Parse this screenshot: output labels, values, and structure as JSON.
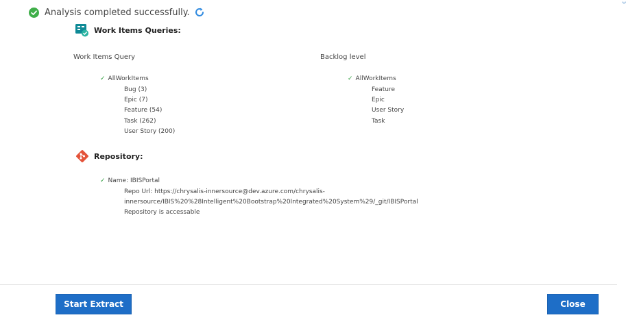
{
  "status": {
    "message": "Analysis completed successfully.",
    "success_icon": "check-circle-icon",
    "refresh_icon": "refresh-icon",
    "success_color": "#3fae49",
    "refresh_color": "#2f8ae0"
  },
  "work_items": {
    "title": "Work Items Queries:",
    "icon": "boards-icon",
    "columns": [
      {
        "header": "Work Items Query",
        "root": "AllWorkItems",
        "children": [
          "Bug (3)",
          "Epic (7)",
          "Feature (54)",
          "Task (262)",
          "User Story (200)"
        ]
      },
      {
        "header": "Backlog level",
        "root": "AllWorkItems",
        "children": [
          "Feature",
          "Epic",
          "User Story",
          "Task"
        ]
      }
    ]
  },
  "repository": {
    "title": "Repository:",
    "icon": "git-icon",
    "name_line": "Name: IBISPortal",
    "url_line1": "Repo Url: https://chrysalis-innersource@dev.azure.com/chrysalis-",
    "url_line2": "innersource/IBIS%20%28Intelligent%20Bootstrap%20Integrated%20System%29/_git/IBISPortal",
    "access_line": "Repository is accessable"
  },
  "footer": {
    "start_label": "Start Extract",
    "close_label": "Close",
    "accent": "#1e6ec7"
  }
}
